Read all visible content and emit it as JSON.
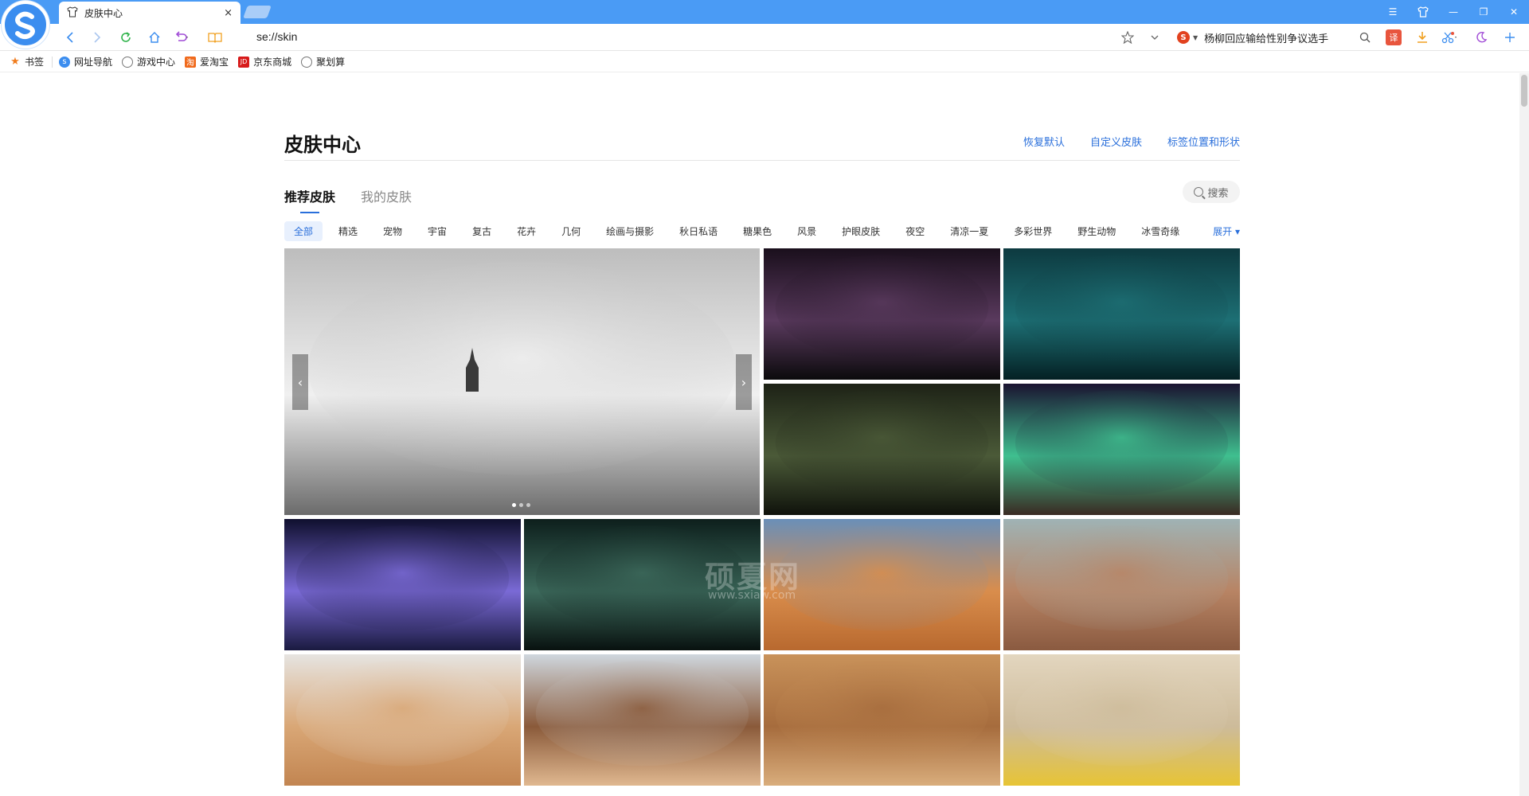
{
  "browser": {
    "tab_title": "皮肤中心",
    "tab_close": "×",
    "url": "se://skin",
    "search_engine_badge": "S",
    "search_query": "杨柳回应输给性别争议选手",
    "window_controls": [
      "☰",
      "👕",
      "—",
      "❐",
      "✕"
    ]
  },
  "bookmarks": [
    {
      "label": "书签",
      "icon": "star-icon"
    },
    {
      "label": "网址导航",
      "icon": "sogou-icon"
    },
    {
      "label": "游戏中心",
      "icon": "globe-icon"
    },
    {
      "label": "爱淘宝",
      "icon": "taobao-icon"
    },
    {
      "label": "京东商城",
      "icon": "jd-icon"
    },
    {
      "label": "聚划算",
      "icon": "globe-icon"
    }
  ],
  "page": {
    "title": "皮肤中心",
    "links": [
      "恢复默认",
      "自定义皮肤",
      "标签位置和形状"
    ],
    "tabs": [
      "推荐皮肤",
      "我的皮肤"
    ],
    "search_label": "搜索",
    "categories": [
      "全部",
      "精选",
      "宠物",
      "宇宙",
      "复古",
      "花卉",
      "几何",
      "绘画与摄影",
      "秋日私语",
      "糖果色",
      "风景",
      "护眼皮肤",
      "夜空",
      "清凉一夏",
      "多彩世界",
      "野生动物",
      "冰雪奇缘"
    ],
    "expand_label": "展开 ▾",
    "watermark": "硕夏网",
    "watermark_sub": "www.sxiaw.com"
  },
  "skins": [
    {
      "name": "castle-in-clouds",
      "colors": [
        "#bdbdbd",
        "#f0f0f0",
        "#6b6b6b"
      ]
    },
    {
      "name": "milky-way-trees",
      "colors": [
        "#1a0f1c",
        "#5a3a5e",
        "#0b0a0c"
      ]
    },
    {
      "name": "underwater-surface",
      "colors": [
        "#0d3a40",
        "#1d6f74",
        "#042023"
      ]
    },
    {
      "name": "fern-leaves",
      "colors": [
        "#1d2216",
        "#4b5a38",
        "#0f120b"
      ]
    },
    {
      "name": "aurora-mountain",
      "colors": [
        "#1a1330",
        "#3fbf8f",
        "#3a2a22"
      ]
    },
    {
      "name": "purple-jellyfish",
      "colors": [
        "#0f0f2e",
        "#7a6ad6",
        "#1a1a40"
      ]
    },
    {
      "name": "starry-night-sky",
      "colors": [
        "#0d1f1c",
        "#3d6a5c",
        "#08110f"
      ]
    },
    {
      "name": "desert-dunes-blue-sky",
      "colors": [
        "#6a8fb8",
        "#d98d4c",
        "#b8692f"
      ]
    },
    {
      "name": "ibex-on-rock",
      "colors": [
        "#9fb3b5",
        "#b88464",
        "#8a5a40"
      ]
    },
    {
      "name": "sand-dunes-hazy",
      "colors": [
        "#e6e4e1",
        "#d9a776",
        "#c28551"
      ]
    },
    {
      "name": "rock-formation-desert",
      "colors": [
        "#cfd7de",
        "#8a5a3a",
        "#e0b890"
      ]
    },
    {
      "name": "desert-ridge-walker",
      "colors": [
        "#c9925a",
        "#a66c3d",
        "#d9ad7c"
      ]
    },
    {
      "name": "sand-with-note",
      "colors": [
        "#e3d6bf",
        "#cdbb9a",
        "#e7c435"
      ]
    }
  ]
}
